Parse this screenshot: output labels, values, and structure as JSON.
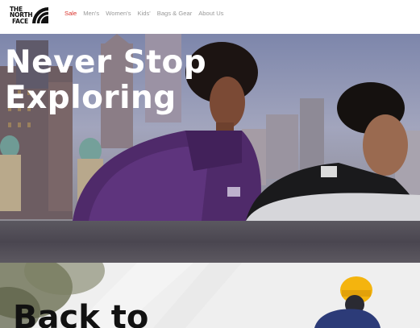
{
  "brand": {
    "logo_line1": "THE",
    "logo_line2": "NORTH",
    "logo_line3": "FACE"
  },
  "nav": {
    "items": [
      {
        "label": "Sale",
        "highlight": true
      },
      {
        "label": "Men's"
      },
      {
        "label": "Women's"
      },
      {
        "label": "Kids'"
      },
      {
        "label": "Bags & Gear"
      },
      {
        "label": "About Us"
      }
    ],
    "sale_color": "#d9322b",
    "link_color": "#9a9a9a"
  },
  "hero": {
    "title_line1": "Never Stop",
    "title_line2": "Exploring",
    "jacket_logo": "THE NORTH FACE"
  },
  "section2": {
    "title": "Back to"
  }
}
